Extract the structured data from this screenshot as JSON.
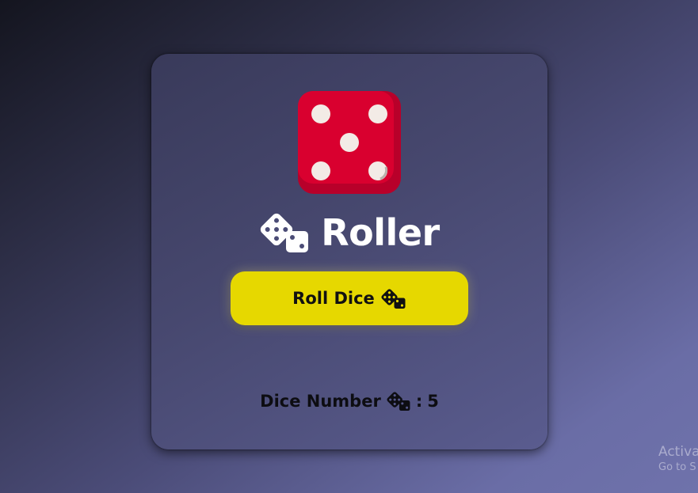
{
  "app": {
    "title": "Roller",
    "title_icon": "dice-icon"
  },
  "die": {
    "value": 5,
    "color": "#d9002f",
    "pip_color": "#f3ebe6"
  },
  "button": {
    "label": "Roll Dice",
    "icon": "dice-icon",
    "color": "#e6d800"
  },
  "result": {
    "label": "Dice Number",
    "icon": "dice-icon",
    "separator": ":",
    "value": "5"
  },
  "watermark": {
    "line1": "Activa",
    "line2": "Go to S"
  }
}
